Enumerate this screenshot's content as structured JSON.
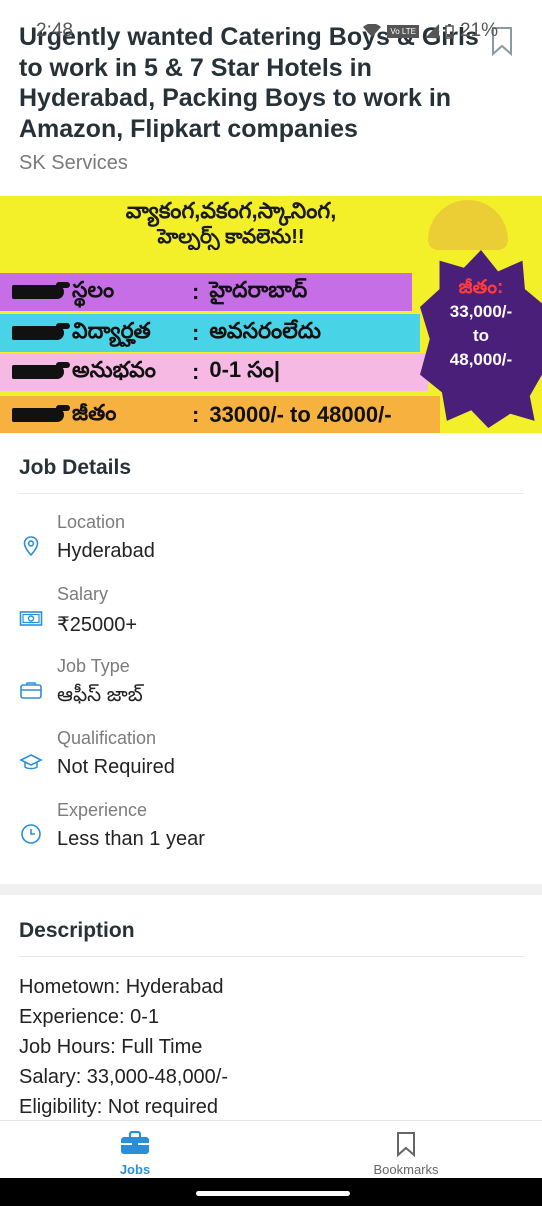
{
  "status_bar": {
    "time": "2:48",
    "battery": "21%",
    "network_badge": "Vo LTE"
  },
  "job": {
    "title": "Urgently wanted Catering Boys & Girls to work in 5 & 7 Star Hotels in Hyderabad, Packing Boys to work in Amazon, Flipkart companies",
    "company": "SK Services"
  },
  "banner": {
    "line1": "వ్యాకంగ,వకంగ,స్కానింగ,",
    "line2": "హెల్పర్స్   కావలెను!!",
    "rows": [
      {
        "label": "స్థలం",
        "value": "హైదరాబాద్"
      },
      {
        "label": "విద్యార్హత",
        "value": "అవసరంలేదు"
      },
      {
        "label": "అనుభవం",
        "value": "0-1 సం|"
      },
      {
        "label": "జీతం",
        "value": "33000/- to 48000/-"
      }
    ],
    "burst_label": "జీతం:",
    "burst_from": "33,000/-",
    "burst_to": "to",
    "burst_upto": "48,000/-"
  },
  "job_details": {
    "heading": "Job Details",
    "items": [
      {
        "label": "Location",
        "value": "Hyderabad",
        "icon": "location-pin-icon"
      },
      {
        "label": "Salary",
        "value": "₹25000+",
        "icon": "cash-icon"
      },
      {
        "label": "Job Type",
        "value": "ఆఫీస్ జాబ్",
        "icon": "briefcase-icon"
      },
      {
        "label": "Qualification",
        "value": "Not Required",
        "icon": "graduation-cap-icon"
      },
      {
        "label": "Experience",
        "value": "Less than 1 year",
        "icon": "clock-icon"
      }
    ]
  },
  "description": {
    "heading": "Description",
    "lines": [
      "Hometown: Hyderabad",
      "Experience: 0-1",
      "Job Hours: Full Time",
      "Salary: 33,000-48,000/-",
      "Eligibility: Not required"
    ]
  },
  "bottom_nav": {
    "jobs": "Jobs",
    "bookmarks": "Bookmarks"
  },
  "colors": {
    "accent": "#2a8fd8",
    "title": "#263238"
  }
}
